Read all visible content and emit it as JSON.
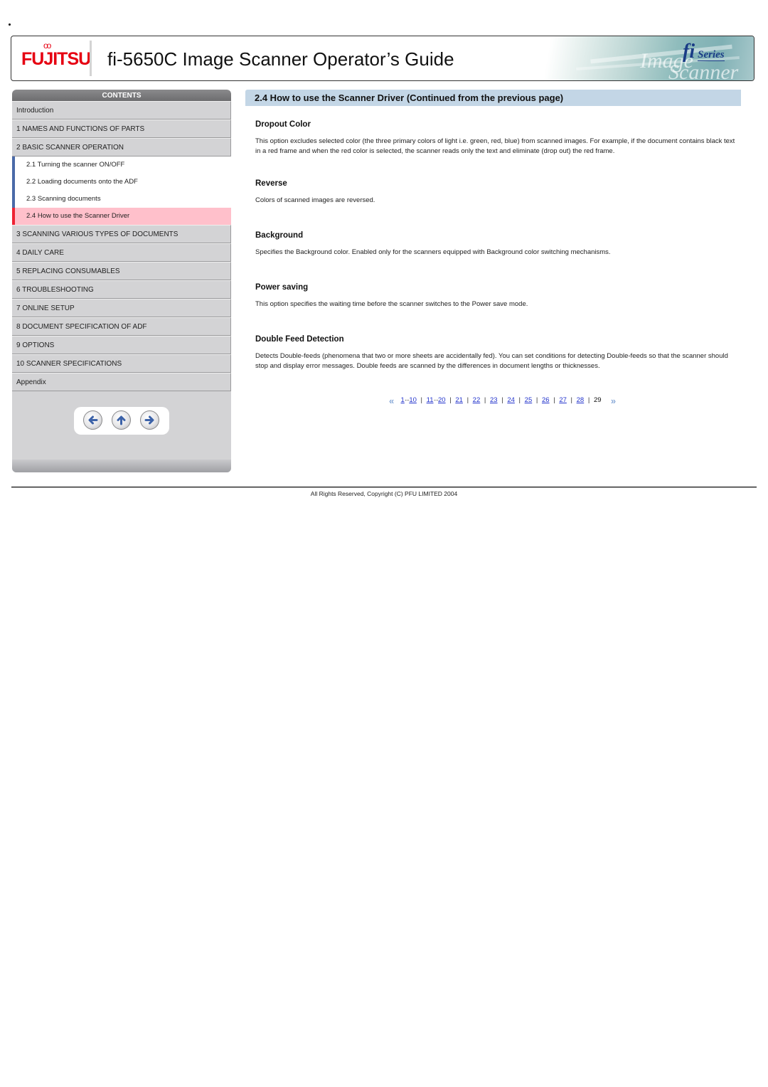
{
  "header": {
    "brand": "FUJITSU",
    "title": "fi-5650C Image Scanner Operator’s Guide",
    "series_logo_fi": "fi",
    "series_logo_text": "Series",
    "art_text_1": "Image",
    "art_text_2": "Scanner"
  },
  "sidebar": {
    "heading": "CONTENTS",
    "items": [
      {
        "label": "Introduction"
      },
      {
        "label": "1 NAMES AND FUNCTIONS OF PARTS"
      },
      {
        "label": "2 BASIC SCANNER OPERATION"
      }
    ],
    "sub_items": [
      {
        "label": "2.1 Turning the scanner ON/OFF",
        "active": false
      },
      {
        "label": "2.2 Loading documents onto the ADF",
        "active": false
      },
      {
        "label": "2.3 Scanning documents",
        "active": false
      },
      {
        "label": "2.4 How to use the Scanner Driver",
        "active": true
      }
    ],
    "items_after": [
      {
        "label": "3 SCANNING VARIOUS TYPES OF DOCUMENTS"
      },
      {
        "label": "4 DAILY CARE"
      },
      {
        "label": "5 REPLACING CONSUMABLES"
      },
      {
        "label": "6 TROUBLESHOOTING"
      },
      {
        "label": "7 ONLINE SETUP"
      },
      {
        "label": "8 DOCUMENT SPECIFICATION OF ADF"
      },
      {
        "label": "9 OPTIONS"
      },
      {
        "label": "10 SCANNER SPECIFICATIONS"
      },
      {
        "label": "Appendix"
      }
    ],
    "nav_buttons": [
      {
        "icon": "arrow-left-icon",
        "label": "Previous"
      },
      {
        "icon": "arrow-up-icon",
        "label": "Up"
      },
      {
        "icon": "arrow-right-icon",
        "label": "Next"
      }
    ]
  },
  "content": {
    "title": "2.4 How to use the Scanner Driver (Continued from the previous page)",
    "sections": [
      {
        "heading": "Dropout Color",
        "body": "This option excludes selected color (the three primary colors of light i.e. green, red, blue) from scanned images. For example, if the document contains black text in a red frame and when the red color is selected, the scanner reads only the text and eliminate (drop out) the red frame."
      },
      {
        "heading": "Reverse",
        "body": "Colors of scanned images are reversed."
      },
      {
        "heading": "Background",
        "body": "Specifies the Background color. Enabled only for the scanners equipped with Background color switching mechanisms."
      },
      {
        "heading": "Power saving",
        "body": "This option specifies the waiting time before the scanner switches to the Power save mode."
      },
      {
        "heading": "Double Feed Detection",
        "body": "Detects Double-feeds (phenomena that two or more sheets are accidentally fed). You can set conditions for detecting Double-feeds so that the scanner should stop and display error messages. Double feeds are scanned by the differences in document lengths or thicknesses."
      }
    ]
  },
  "pager": {
    "prev_symbol": "<<",
    "next_symbol": ">>",
    "range1_start": "1",
    "range1_dots": "···",
    "range1_end": "10",
    "range2_start": "11",
    "range2_dots": "···",
    "range2_end": "20",
    "pages": [
      "21",
      "22",
      "23",
      "24",
      "25",
      "26",
      "27",
      "28"
    ],
    "current": "29",
    "separator": "|"
  },
  "footer": {
    "copyright": "All Rights Reserved, Copyright (C) PFU LIMITED 2004"
  },
  "colors": {
    "brand_red": "#e60012",
    "title_bar_bg": "#c3d6e6",
    "sidebar_bg": "#d3d3d5",
    "active_item_bg": "#ffc0cb",
    "active_marker": "#ee2233",
    "sub_marker": "#4a6aa8",
    "link": "#2233cc"
  }
}
